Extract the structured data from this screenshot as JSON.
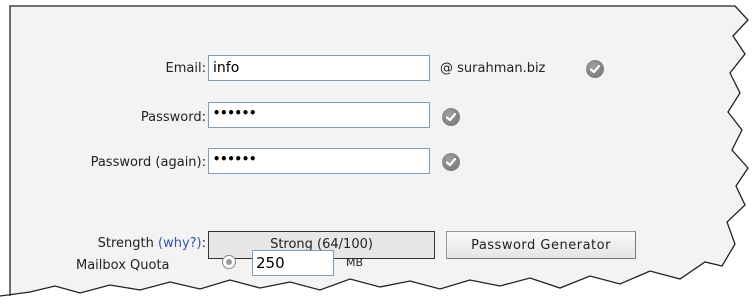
{
  "form": {
    "email": {
      "label": "Email:",
      "value": "info",
      "domain": "@ surahman.biz"
    },
    "password": {
      "label": "Password:",
      "value": "••••••"
    },
    "password_again": {
      "label": "Password (again):",
      "value": "••••••"
    },
    "strength": {
      "label": "Strength",
      "why_link": "(why?)",
      "colon": ":",
      "value": "Strong (64/100)"
    },
    "generator_button": "Password Generator",
    "mailbox_quota": {
      "label": "Mailbox Quota",
      "value": "250",
      "unit": "MB"
    }
  },
  "icons": {
    "valid": "checkmark-icon",
    "radio": "radio-selected"
  },
  "colors": {
    "panel": "#f3f3f3",
    "check": "#7a7a7a",
    "link": "#3355aa",
    "input_border": "#7f9db9"
  }
}
